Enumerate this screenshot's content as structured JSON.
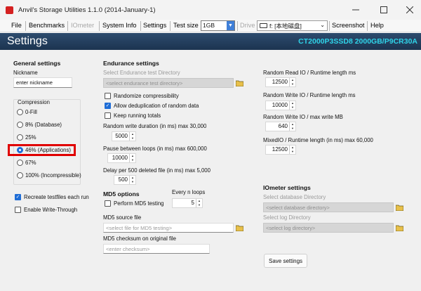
{
  "window": {
    "title": "Anvil's Storage Utilities 1.1.0 (2014-January-1)",
    "minimize_icon": "minimize-icon",
    "maximize_icon": "maximize-icon",
    "close_icon": "close-icon"
  },
  "menu": {
    "file": "File",
    "benchmarks": "Benchmarks",
    "iometer": "IOmeter",
    "system_info": "System Info",
    "settings": "Settings",
    "test_size_label": "Test size",
    "test_size_value": "1GB",
    "drive_label": "Drive",
    "drive_value": "f: [本地磁盘]",
    "screenshot": "Screenshot",
    "help": "Help"
  },
  "header": {
    "title": "Settings",
    "drive_info": "CT2000P3SSD8 2000GB/P9CR30A"
  },
  "general": {
    "heading": "General settings",
    "nickname_label": "Nickname",
    "nickname_value": "enter nickname",
    "compression_label": "Compression",
    "options": [
      "0-Fill",
      "8% (Database)",
      "25%",
      "46% (Applications)",
      "67%",
      "100% (Incompressible)"
    ],
    "selected_index": 3,
    "recreate_label": "Recreate testfiles each run",
    "recreate_checked": true,
    "write_through_label": "Enable Write-Through",
    "write_through_checked": false
  },
  "endurance": {
    "heading": "Endurance settings",
    "dir_label": "Select Endurance test Directory",
    "dir_placeholder": "<select endurance test directory>",
    "randomize_label": "Randomize compressibility",
    "randomize_checked": false,
    "dedup_label": "Allow deduplication of random data",
    "dedup_checked": true,
    "keep_label": "Keep running totals",
    "keep_checked": false,
    "random_write_label": "Random write duration (in ms) max 30,000",
    "random_write_value": "5000",
    "pause_label": "Pause between loops (in ms) max 600,000",
    "pause_value": "10000",
    "delay_label": "Delay per 500 deleted file (in ms) max 5,000",
    "delay_value": "500"
  },
  "md5": {
    "heading": "MD5 options",
    "every_label": "Every n loops",
    "every_value": "5",
    "perform_label": "Perform MD5 testing",
    "perform_checked": false,
    "source_label": "MD5 source file",
    "source_placeholder": "<select file for MD5 testing>",
    "checksum_label": "MD5 checksum on original file",
    "checksum_placeholder": "<enter checksum>"
  },
  "runtime": {
    "rr_label": "Random Read IO / Runtime length ms",
    "rr_value": "12500",
    "rw_label": "Random Write IO / Runtime length ms",
    "rw_value": "10000",
    "rwmax_label": "Random Write IO / max write MB",
    "rwmax_value": "640",
    "mixed_label": "MixedIO / Runtime length (in ms) max 60,000",
    "mixed_value": "12500"
  },
  "iometer_settings": {
    "heading": "IOmeter settings",
    "db_label": "Select database Directory",
    "db_placeholder": "<select database directory>",
    "log_label": "Select log Directory",
    "log_placeholder": "<select log directory>"
  },
  "buttons": {
    "save": "Save settings"
  },
  "colors": {
    "header_bg": "#1c3450",
    "header_accent": "#2fd3e8",
    "selection_highlight": "#e00000",
    "checkbox_blue": "#1f6dd6"
  }
}
